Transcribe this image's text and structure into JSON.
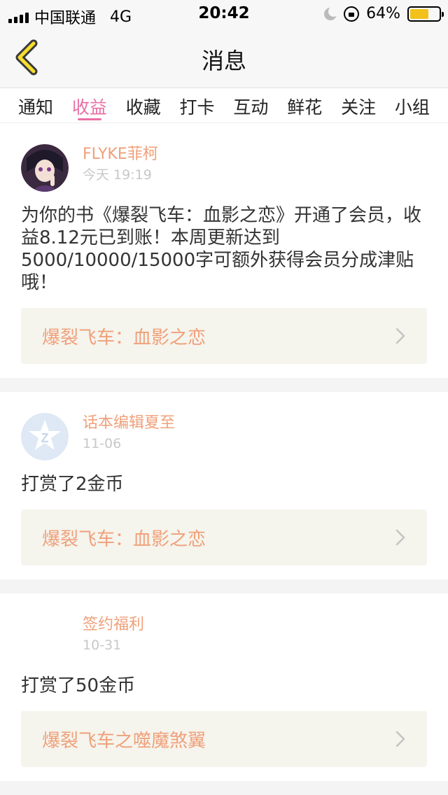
{
  "status_bar": {
    "carrier": "中国联通",
    "network": "4G",
    "time": "20:42",
    "battery": "64%",
    "battery_level": 0.64
  },
  "nav": {
    "title": "消息",
    "back_icon": "chevron-left-icon"
  },
  "tabs": [
    {
      "label": "通知",
      "active": false
    },
    {
      "label": "收益",
      "active": true
    },
    {
      "label": "收藏",
      "active": false
    },
    {
      "label": "打卡",
      "active": false
    },
    {
      "label": "互动",
      "active": false
    },
    {
      "label": "鲜花",
      "active": false
    },
    {
      "label": "关注",
      "active": false
    },
    {
      "label": "小组",
      "active": false
    }
  ],
  "messages": [
    {
      "sender": "FLYKE菲柯",
      "time": "今天 19:19",
      "text": "为你的书《爆裂飞车：血影之恋》开通了会员，收益8.12元已到账！本周更新达到5000/10000/15000字可额外获得会员分成津贴哦！",
      "book": "爆裂飞车：血影之恋"
    },
    {
      "sender": "话本编辑夏至",
      "time": "11-06",
      "text": "打赏了2金币",
      "book": "爆裂飞车：血影之恋"
    },
    {
      "sender": "签约福利",
      "time": "10-31",
      "text": "打赏了50金币",
      "book": "爆裂飞车之噬魔煞翼"
    }
  ],
  "colors": {
    "accent": "#e96fa6",
    "sender": "#f0a07a",
    "book_bg": "#f5f4ed"
  }
}
